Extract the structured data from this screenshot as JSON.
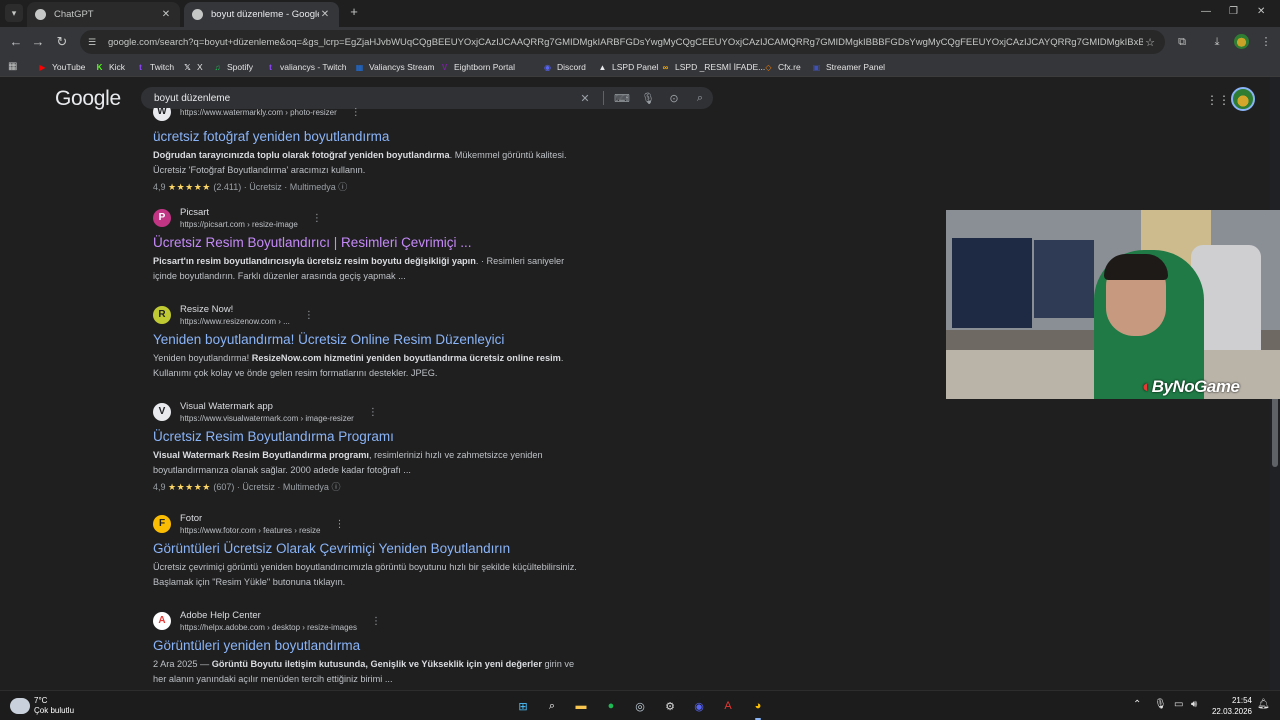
{
  "browser": {
    "tabs": [
      {
        "title": "ChatGPT",
        "active": false
      },
      {
        "title": "boyut düzenleme - Google'da A",
        "active": true
      }
    ],
    "url": "google.com/search?q=boyut+düzenleme&oq=&gs_lcrp=EgZjaHJvbWUqCQgBEEUYOxjCAzIJCAAQRRg7GMIDMgkIARBFGDsYwgMyCQgCEEUYOxjCAzIJCAMQRRg7GMIDMgkIBBBFGDsYwgMyCQgFEEUYOxjCAzIJCAYQRRg7GMIDMgkIBxBFGDsYwgPSA...",
    "bookmarks": [
      {
        "label": "YouTube",
        "color": "#ff0000",
        "glyph": "▶"
      },
      {
        "label": "Kick",
        "color": "#53fc18",
        "glyph": "K"
      },
      {
        "label": "Twitch",
        "color": "#9146ff",
        "glyph": "t"
      },
      {
        "label": "X",
        "color": "#e8eaed",
        "glyph": "𝕏"
      },
      {
        "label": "Spotify",
        "color": "#1db954",
        "glyph": "♫"
      },
      {
        "label": "valiancys - Twitch",
        "color": "#9146ff",
        "glyph": "t"
      },
      {
        "label": "Valiancys Stream",
        "color": "#1a73e8",
        "glyph": "▦"
      },
      {
        "label": "Eightborn Portal",
        "color": "#7b1fa2",
        "glyph": "V"
      },
      {
        "label": "Discord",
        "color": "#5865f2",
        "glyph": "◉"
      },
      {
        "label": "LSPD Panel",
        "color": "#e8eaed",
        "glyph": "▲"
      },
      {
        "label": "LSPD _RESMİ İFADE...",
        "color": "#f9ab00",
        "glyph": "∞"
      },
      {
        "label": "Cfx.re",
        "color": "#f57c00",
        "glyph": "◇"
      },
      {
        "label": "Streamer Panel",
        "color": "#3f51b5",
        "glyph": "▣"
      }
    ]
  },
  "google": {
    "logo": "Google",
    "query": "boyut düzenleme"
  },
  "results": [
    {
      "cite": "https://www.watermarkly.com › photo-resizer",
      "site": "",
      "icon_glyph": "W",
      "icon_color": "#e8eaed",
      "title": "ücretsiz fotoğraf yeniden boyutlandırma",
      "visited": false,
      "snippet_bold_1": "Doğrudan tarayıcınızda toplu olarak fotoğraf yeniden boyutlandırma",
      "snippet_1": ". Mükemmel görüntü kalitesi.",
      "snippet_2": "Ücretsiz 'Fotoğraf Boyutlandırma' aracımızı kullanın.",
      "rating": "4,9",
      "stars": "★★★★★",
      "count": "(2.411)",
      "price": "Ücretsiz",
      "category": "Multimedya"
    },
    {
      "cite": "https://picsart.com › resize-image",
      "site": "Picsart",
      "icon_glyph": "P",
      "icon_color": "#c13584",
      "title": "Ücretsiz Resim Boyutlandırıcı | Resimleri Çevrimiçi ...",
      "visited": true,
      "snippet_bold_1": "Picsart'ın resim boyutlandırıcısıyla ücretsiz resim boyutu değişikliği yapın",
      "snippet_1": ". · Resimleri saniyeler",
      "snippet_2": "içinde boyutlandırın. Farklı düzenler arasında geçiş yapmak ..."
    },
    {
      "cite": "https://www.resizenow.com › ...",
      "site": "Resize Now!",
      "icon_glyph": "R",
      "icon_color": "#c0ca33",
      "title": "Yeniden boyutlandırma! Ücretsiz Online Resim Düzenleyici",
      "visited": false,
      "snippet_pre": "Yeniden boyutlandırma! ",
      "snippet_bold_1": "ResizeNow.com hizmetini yeniden boyutlandırma ücretsiz online resim",
      "snippet_1": ".",
      "snippet_2": "Kullanımı çok kolay ve önde gelen resim formatlarını destekler. JPEG."
    },
    {
      "cite": "https://www.visualwatermark.com › image-resizer",
      "site": "Visual Watermark app",
      "icon_glyph": "V",
      "icon_color": "#e8eaed",
      "title": "Ücretsiz Resim Boyutlandırma Programı",
      "visited": false,
      "snippet_bold_1": "Visual Watermark Resim Boyutlandırma programı",
      "snippet_1": ", resimlerinizi hızlı ve zahmetsizce yeniden",
      "snippet_2": "boyutlandırmanıza olanak sağlar. 2000 adede kadar fotoğrafı ...",
      "rating": "4,9",
      "stars": "★★★★★",
      "count": "(607)",
      "price": "Ücretsiz",
      "category": "Multimedya"
    },
    {
      "cite": "https://www.fotor.com › features › resize",
      "site": "Fotor",
      "icon_glyph": "F",
      "icon_color": "#fbbc04",
      "title": "Görüntüleri Ücretsiz Olarak Çevrimiçi Yeniden Boyutlandırın",
      "visited": false,
      "snippet_1": "Ücretsiz çevrimiçi görüntü yeniden boyutlandırıcımızla görüntü boyutunu hızlı bir şekilde küçültebilirsiniz.",
      "snippet_2": "Başlamak için \"Resim Yükle\" butonuna tıklayın."
    },
    {
      "cite": "https://helpx.adobe.com › desktop › resize-images",
      "site": "Adobe Help Center",
      "icon_glyph": "A",
      "icon_color": "#e8eaed",
      "title": "Görüntüleri yeniden boyutlandırma",
      "visited": false,
      "snippet_date": "2 Ara 2025 — ",
      "snippet_bold_1": "Görüntü Boyutu iletişim kutusunda, Genişlik ve Yükseklik için yeni değerler",
      "snippet_1": " girin ve",
      "snippet_2": "her alanın yanındaki açılır menüden tercih ettiğiniz birimi ..."
    }
  ],
  "overlay": {
    "brand": "ByNoGame"
  },
  "taskbar": {
    "temperature": "7°C",
    "condition": "Çok bulutlu",
    "time": "21:54",
    "date": "22.03.2026"
  }
}
